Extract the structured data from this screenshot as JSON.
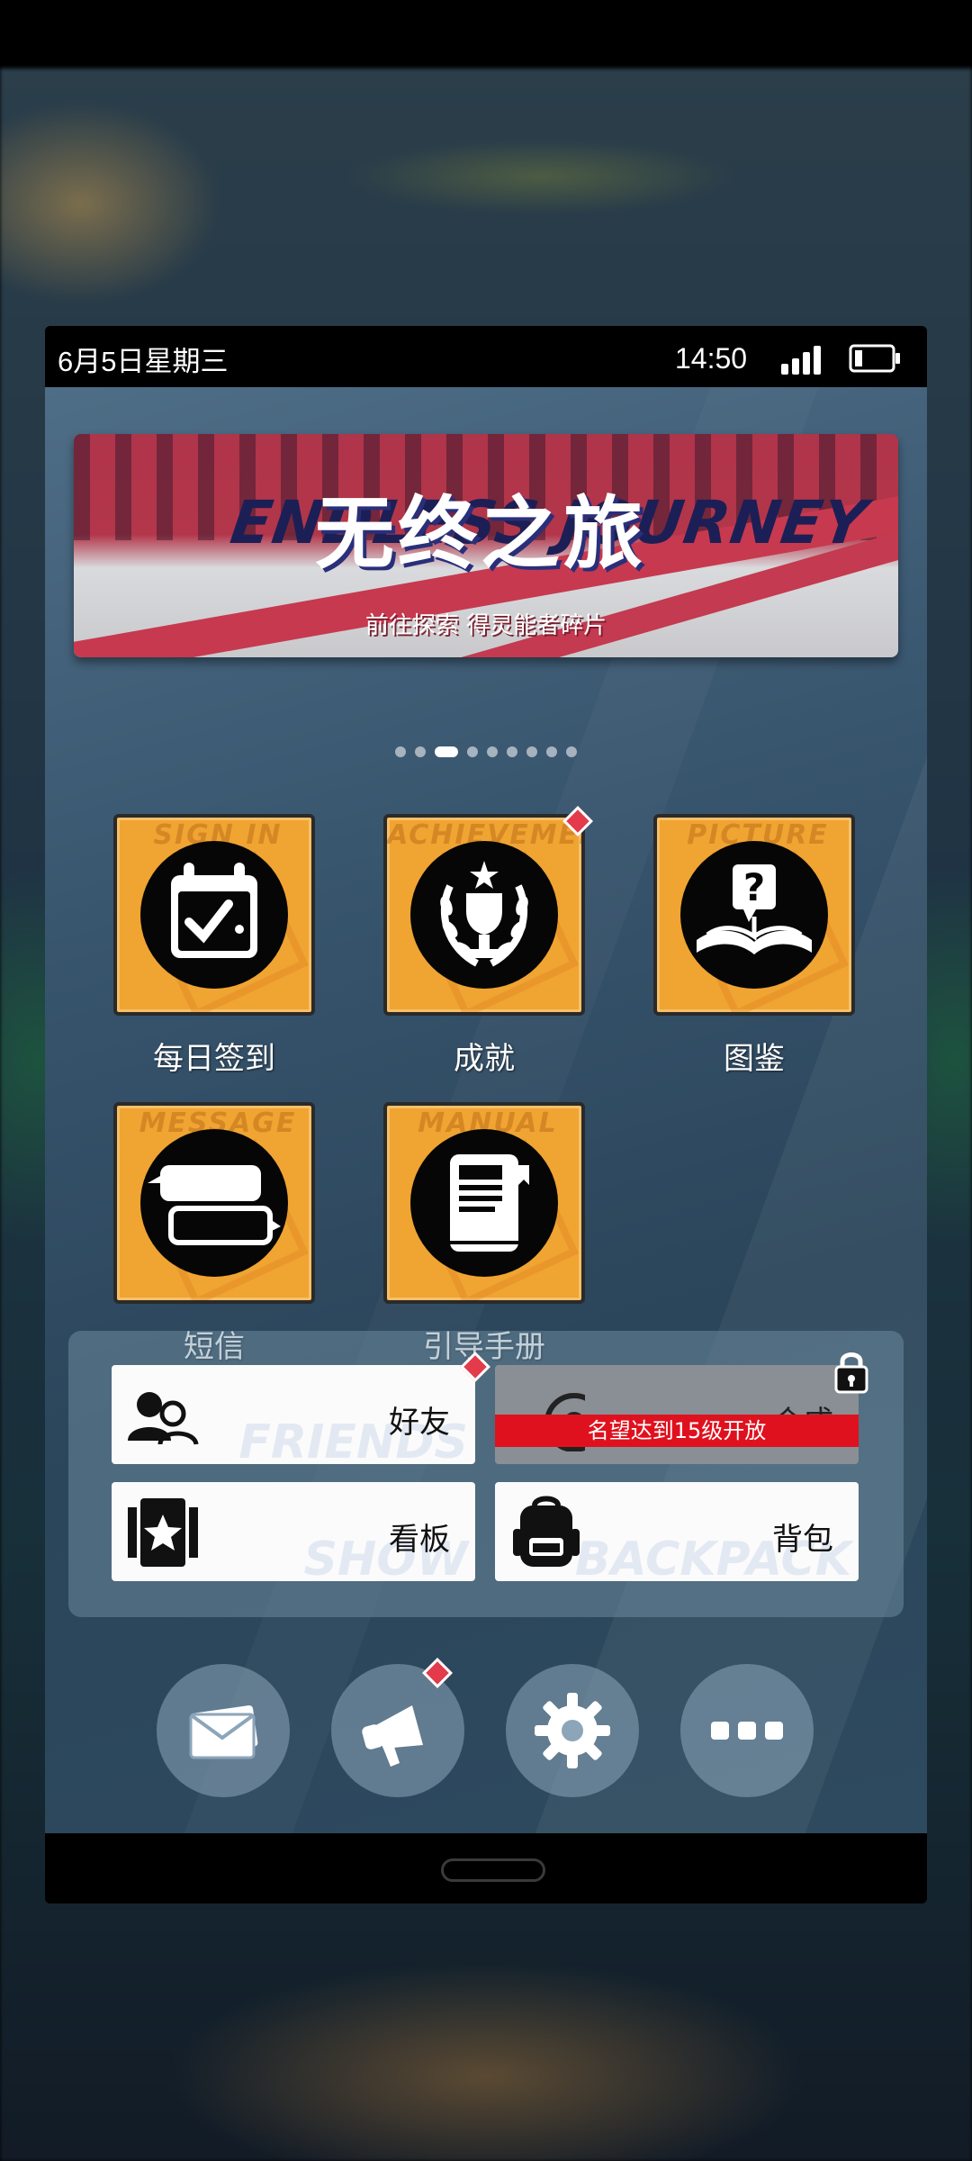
{
  "status_bar": {
    "date": "6月5日星期三",
    "time": "14:50"
  },
  "banner": {
    "title_cn": "无终之旅",
    "title_en": "ENDLESS JOURNEY",
    "subtitle": "前往探索 得灵能者碎片",
    "page_count": 9,
    "active_page": 3
  },
  "apps": [
    {
      "label": "每日签到",
      "watermark": "SIGN IN",
      "icon": "calendar-check-icon"
    },
    {
      "label": "成就",
      "watermark": "ACHIEVEMENT",
      "icon": "trophy-laurel-icon",
      "badge": true
    },
    {
      "label": "图鉴",
      "watermark": "PICTURE",
      "icon": "question-book-icon"
    },
    {
      "label": "短信",
      "watermark": "MESSAGE",
      "icon": "chat-bubbles-icon"
    },
    {
      "label": "引导手册",
      "watermark": "MANUAL",
      "icon": "manual-book-icon"
    }
  ],
  "panel": {
    "friends": {
      "label": "好友",
      "watermark": "FRIENDS",
      "badge": true,
      "icon": "friends-icon"
    },
    "synthesis": {
      "label": "合成",
      "locked_text": "名望达到15级开放",
      "locked": true,
      "icon": "synthesis-icon"
    },
    "show": {
      "label": "看板",
      "watermark": "SHOW",
      "icon": "star-card-icon"
    },
    "backpack": {
      "label": "背包",
      "watermark": "BACKPACK",
      "icon": "backpack-icon"
    }
  },
  "bottom_buttons": [
    {
      "name": "mail",
      "icon": "mail-icon"
    },
    {
      "name": "announcement",
      "icon": "megaphone-icon",
      "badge": true
    },
    {
      "name": "settings",
      "icon": "gear-icon"
    },
    {
      "name": "more",
      "icon": "more-dots-icon"
    }
  ],
  "colors": {
    "tile": "#f0a432",
    "badge": "#e33b4b",
    "lock_bar": "#e0111e",
    "banner_red": "#b0344a"
  }
}
